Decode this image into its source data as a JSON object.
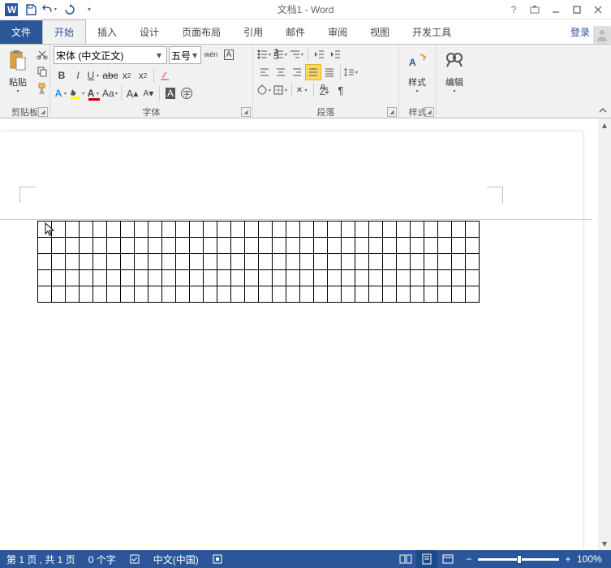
{
  "title": "文档1 - Word",
  "qat": {
    "undo": "↶",
    "redo": "↷"
  },
  "tabs": {
    "file": "文件",
    "home": "开始",
    "insert": "插入",
    "design": "设计",
    "layout": "页面布局",
    "references": "引用",
    "mailings": "邮件",
    "review": "审阅",
    "view": "视图",
    "developer": "开发工具"
  },
  "login": "登录",
  "groups": {
    "clipboard": {
      "label": "剪贴板",
      "paste": "粘贴"
    },
    "font": {
      "label": "字体",
      "name": "宋体 (中文正文)",
      "size": "五号"
    },
    "paragraph": {
      "label": "段落"
    },
    "styles": {
      "label": "样式",
      "btn": "样式"
    },
    "editing": {
      "label": "编辑"
    }
  },
  "status": {
    "page": "第 1 页 , 共 1 页",
    "words": "0 个字",
    "lang": "中文(中国)",
    "zoom": "100%"
  },
  "table": {
    "rows": 5,
    "cols": 32
  }
}
